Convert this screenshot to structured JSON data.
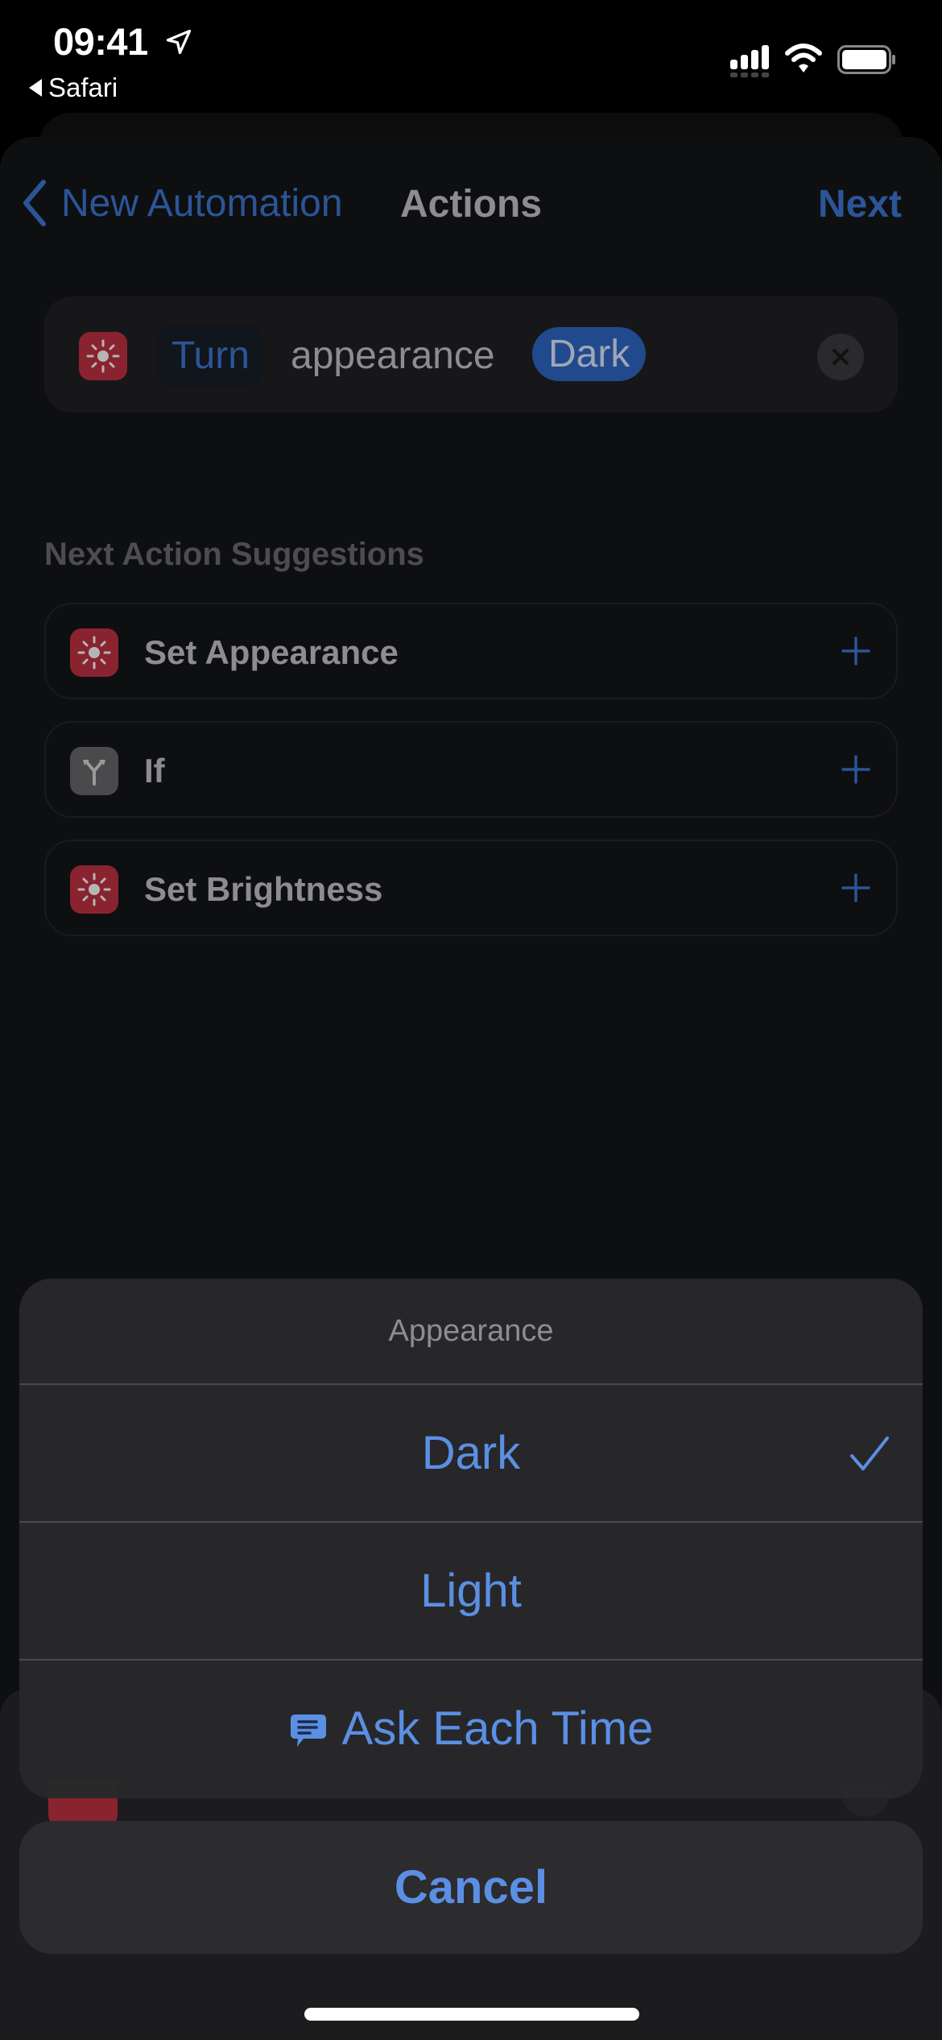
{
  "status_bar": {
    "time": "09:41",
    "back_app": "Safari",
    "icons": [
      "location-arrow-icon",
      "cellular-signal-icon",
      "wifi-icon",
      "battery-icon"
    ]
  },
  "nav": {
    "back_label": "New Automation",
    "title": "Actions",
    "next_label": "Next"
  },
  "action": {
    "icon": "sun-icon",
    "verb": "Turn",
    "text": "appearance",
    "value": "Dark",
    "remove_icon": "close-icon"
  },
  "suggestions": {
    "header": "Next Action Suggestions",
    "items": [
      {
        "label": "Set Appearance",
        "icon": "sun-icon",
        "color": "#8a2330"
      },
      {
        "label": "If",
        "icon": "branch-icon",
        "color": "#4a4a4d"
      },
      {
        "label": "Set Brightness",
        "icon": "sun-icon",
        "color": "#8a2330"
      }
    ]
  },
  "action_sheet": {
    "title": "Appearance",
    "options": [
      {
        "label": "Dark",
        "selected": true
      },
      {
        "label": "Light",
        "selected": false
      },
      {
        "label": "Ask Each Time",
        "icon": "speech-bubble-icon",
        "selected": false
      }
    ],
    "cancel_label": "Cancel"
  },
  "colors": {
    "accent": "#5b8fe3",
    "accent_dimmed": "#2b5597",
    "action_icon_red": "#8a2330",
    "sheet_background": "#0e0f11"
  }
}
